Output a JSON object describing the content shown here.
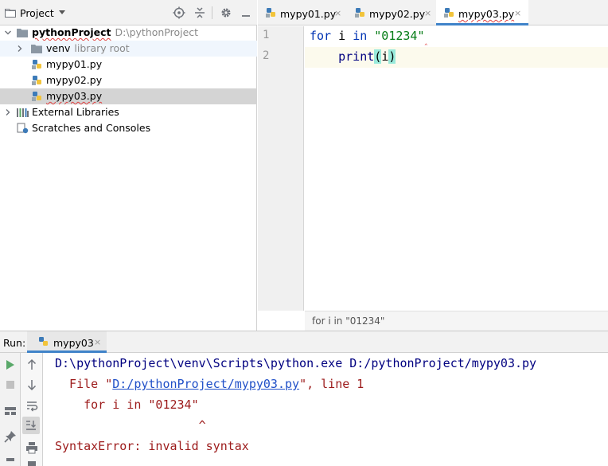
{
  "project_panel": {
    "title": "Project",
    "tree": [
      {
        "label": "pythonProject",
        "sublabel": "D:\\pythonProject"
      },
      {
        "label": "venv",
        "sublabel": "library root"
      },
      {
        "label": "mypy01.py"
      },
      {
        "label": "mypy02.py"
      },
      {
        "label": "mypy03.py"
      },
      {
        "label": "External Libraries"
      },
      {
        "label": "Scratches and Consoles"
      }
    ]
  },
  "editor": {
    "tabs": [
      {
        "label": "mypy01.py",
        "close": "×"
      },
      {
        "label": "mypy02.py",
        "close": "×"
      },
      {
        "label": "mypy03.py",
        "close": "×",
        "active": true
      }
    ],
    "line_numbers": [
      "1",
      "2"
    ],
    "code": {
      "line1": {
        "kw_for": "for",
        "var": " i ",
        "kw_in": "in",
        "sp": " ",
        "str": "\"01234\""
      },
      "line2": {
        "indent": "    ",
        "fn": "print",
        "open": "(",
        "arg": "i",
        "close": ")"
      }
    },
    "breadcrumb": "for i in \"01234\""
  },
  "run_panel": {
    "label": "Run:",
    "tab": {
      "label": "mypy03",
      "close": "×"
    },
    "console": {
      "line1": "D:\\pythonProject\\venv\\Scripts\\python.exe D:/pythonProject/mypy03.py",
      "line2_prefix": "  File \"",
      "line2_link": "D:/pythonProject/mypy03.py",
      "line2_suffix": "\", line 1",
      "line3": "    for i in \"01234\"",
      "line4": "                    ^",
      "line5": "SyntaxError: invalid syntax"
    }
  },
  "colors": {
    "accent": "#4083c9",
    "keyword": "#0033b3",
    "string": "#067d17",
    "error_text": "#9c1a1a",
    "link": "#2050c8",
    "selection": "#d4d4d4"
  }
}
